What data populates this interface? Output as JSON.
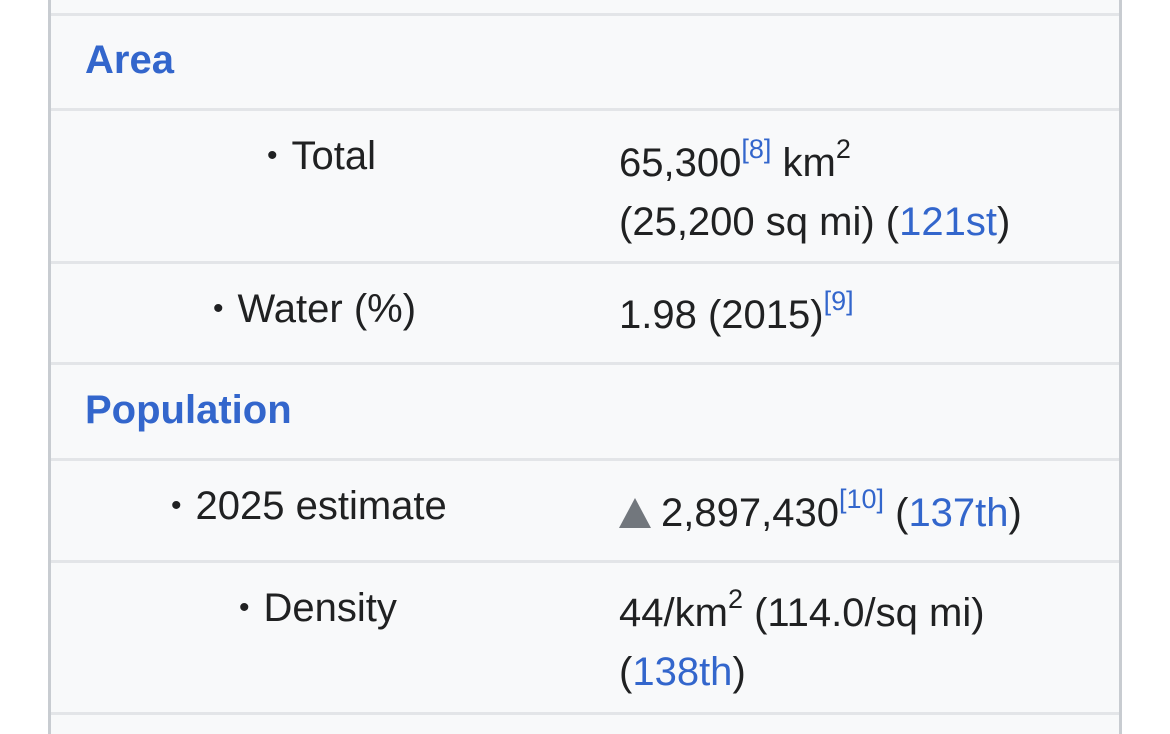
{
  "area": {
    "header": "Area",
    "total_label": "Total",
    "total_value": "65,300",
    "total_ref": "[8]",
    "total_unit": "km",
    "total_unit_exp": "2",
    "total_alt_open": "(25,200 sq mi) (",
    "total_rank": "121st",
    "total_alt_close": ")",
    "water_label": "Water (%)",
    "water_value": "1.98 (2015)",
    "water_ref": "[9]"
  },
  "population": {
    "header": "Population",
    "estimate_label": "2025 estimate",
    "estimate_value": "2,897,430",
    "estimate_ref": "[10]",
    "estimate_rank_open": " (",
    "estimate_rank": "137th",
    "estimate_rank_close": ")",
    "density_label": "Density",
    "density_value": "44/km",
    "density_exp": "2",
    "density_alt": " (114.0/sq mi)",
    "density_rank_open": "(",
    "density_rank": "138th",
    "density_rank_close": ")"
  },
  "colors": {
    "link": "#3366cc",
    "border": "#c8ccd1",
    "background": "#f8f9fa",
    "trend_up": "#72777d"
  },
  "icons": {
    "bullet": "•",
    "trend": "increase-triangle-icon"
  }
}
